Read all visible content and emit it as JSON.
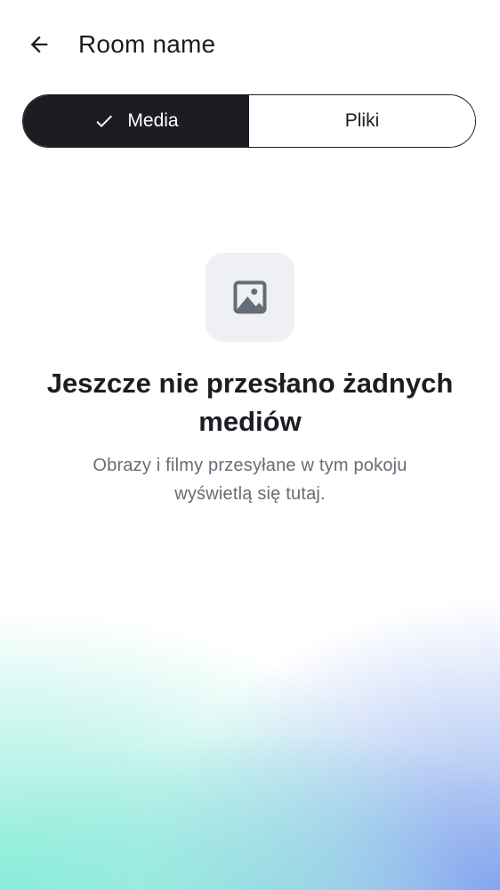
{
  "header": {
    "title": "Room name"
  },
  "tabs": [
    {
      "label": "Media",
      "selected": true
    },
    {
      "label": "Pliki",
      "selected": false
    }
  ],
  "empty_state": {
    "icon": "image-icon",
    "title": "Jeszcze nie przesłano żadnych mediów",
    "description": "Obrazy i filmy przesyłane w tym pokoju wyświetlą się tutaj."
  },
  "colors": {
    "primary": "#1b1d22",
    "secondary_text": "#656d77",
    "icon_box": "#eef0f4",
    "gradient_left": "#82ecd6",
    "gradient_right": "#80a0ee"
  }
}
